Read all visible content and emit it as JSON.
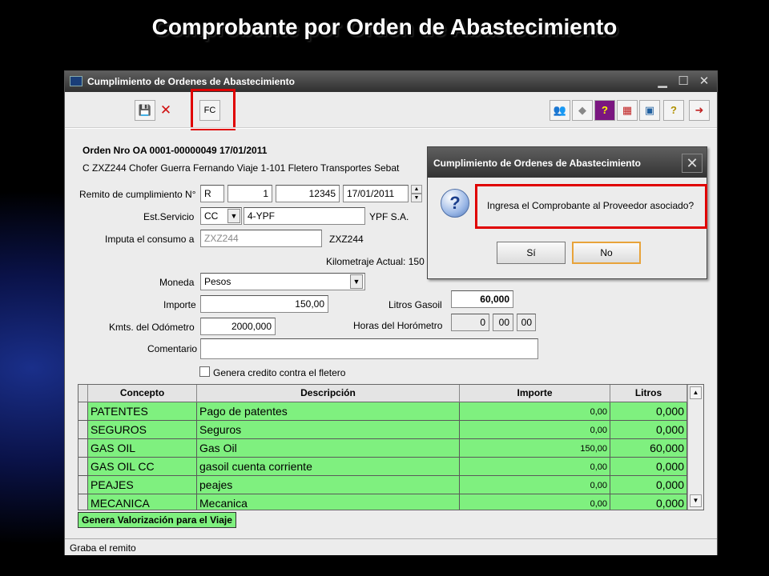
{
  "slide_title": "Comprobante por Orden de Abastecimiento",
  "window": {
    "title": "Cumplimiento de Ordenes de Abastecimiento",
    "min": "▁",
    "max": "☐",
    "close": "✕"
  },
  "toolbar": {
    "save": "💾",
    "cancel": "✕",
    "fc": "FC",
    "find": "👥",
    "tag": "◆",
    "help1": "?",
    "calc": "▦",
    "screen": "▣",
    "help2": "?",
    "exit": "➜"
  },
  "order": {
    "header": "Orden Nro OA 0001-00000049 17/01/2011",
    "detail": "C ZXZ244    Chofer Guerra Fernando Viaje 1-101 Fletero Transportes Sebat"
  },
  "form": {
    "remito_label": "Remito de cumplimiento N°",
    "remito_letter": "R",
    "remito_pv": "1",
    "remito_num": "12345",
    "remito_date": "17/01/2011",
    "est_label": "Est.Servicio",
    "est_code": "CC",
    "est_name": "4-YPF",
    "est_desc": "YPF S.A.",
    "imputa_label": "Imputa el consumo a",
    "imputa_value": "ZXZ244",
    "imputa_desc": "ZXZ244",
    "km_actual": "Kilometraje Actual: 150",
    "moneda_label": "Moneda",
    "moneda_value": "Pesos",
    "importe_label": "Importe",
    "importe_value": "150,00",
    "litros_label": "Litros Gasoil",
    "litros_value": "60,000",
    "kmts_label": "Kmts. del Odómetro",
    "kmts_value": "2000,000",
    "horas_label": "Horas del Horómetro",
    "horas_h": "0",
    "horas_m": "00",
    "horas_s": "00",
    "comentario_label": "Comentario",
    "comentario_value": "",
    "credito_label": "Genera credito contra el fletero"
  },
  "grid": {
    "headers": [
      "Concepto",
      "Descripción",
      "Importe",
      "Litros"
    ],
    "rows": [
      {
        "concepto": "PATENTES",
        "descripcion": "Pago de patentes",
        "importe": "0,00",
        "litros": "0,000"
      },
      {
        "concepto": "SEGUROS",
        "descripcion": "Seguros",
        "importe": "0,00",
        "litros": "0,000"
      },
      {
        "concepto": "GAS OIL",
        "descripcion": "Gas Oil",
        "importe": "150,00",
        "litros": "60,000"
      },
      {
        "concepto": "GAS OIL CC",
        "descripcion": "gasoil cuenta corriente",
        "importe": "0,00",
        "litros": "0,000"
      },
      {
        "concepto": "PEAJES",
        "descripcion": "peajes",
        "importe": "0,00",
        "litros": "0,000"
      },
      {
        "concepto": "MECANICA",
        "descripcion": "Mecanica",
        "importe": "0,00",
        "litros": "0,000"
      }
    ]
  },
  "valoriza_label": "Genera Valorización para el Viaje",
  "status_text": "Graba el remito",
  "dialog": {
    "title": "Cumplimiento de Ordenes de Abastecimiento",
    "close": "✕",
    "icon": "?",
    "message": "Ingresa el Comprobante al Proveedor asociado?",
    "yes": "Sí",
    "no": "No"
  }
}
